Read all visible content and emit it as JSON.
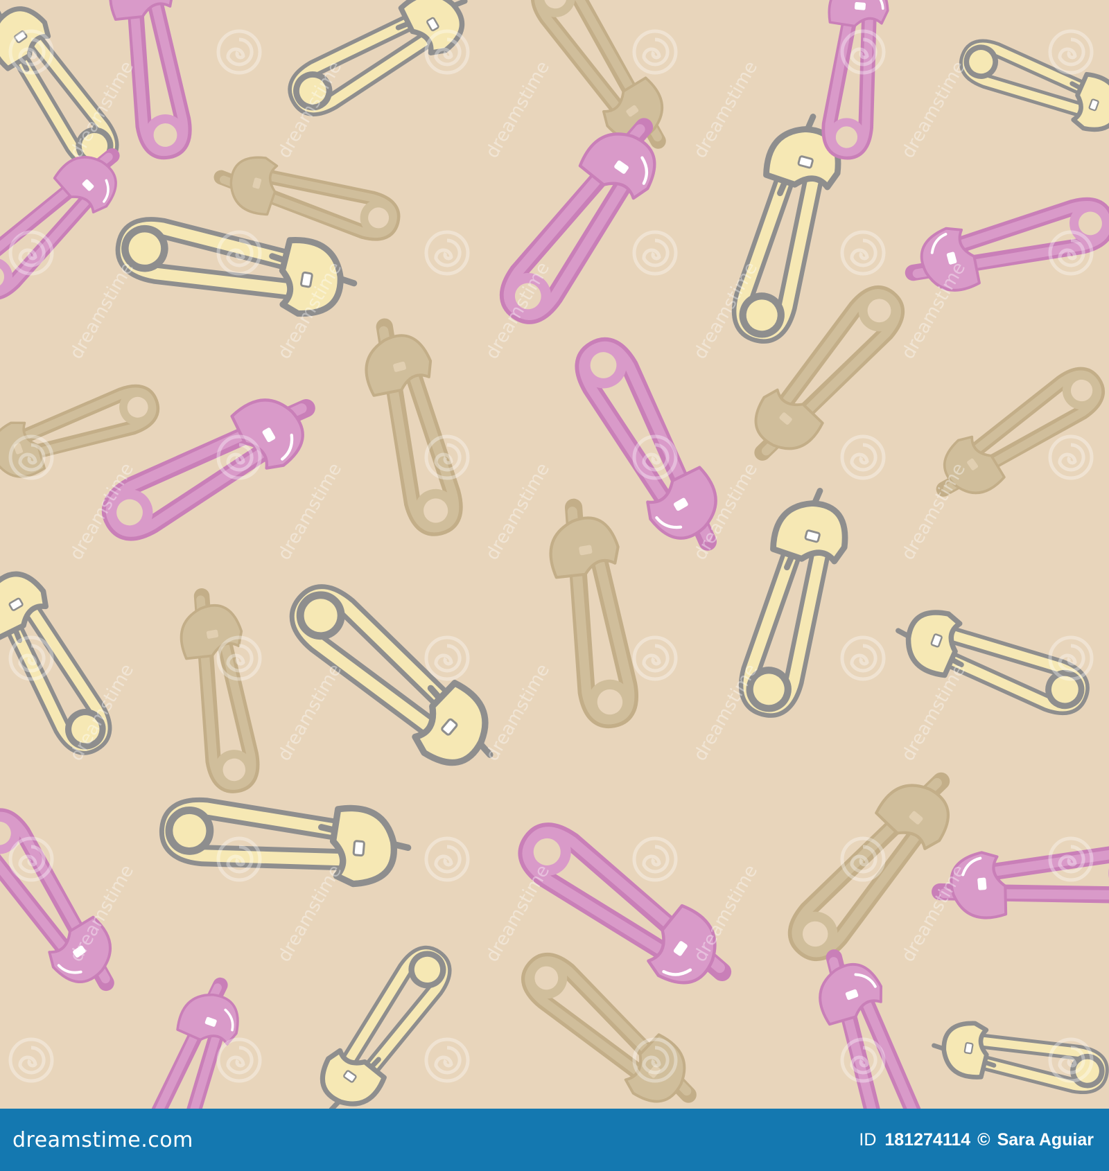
{
  "image": {
    "background_color": "#e8d5bb",
    "colors": {
      "pink_pin": "#d99ac9",
      "pink_pin_outline": "#c97fb8",
      "cream_pin": "#f6e8b4",
      "grey_outline": "#8e8e8e",
      "tan_pin": "#d0be9b"
    },
    "watermark_text": "dreamstime"
  },
  "footer": {
    "background_color": "#1478b0",
    "site": "dreamstime.com",
    "id_label": "ID",
    "id_number": "181274114",
    "copyright_symbol": "©",
    "author": "Sara Aguiar"
  }
}
